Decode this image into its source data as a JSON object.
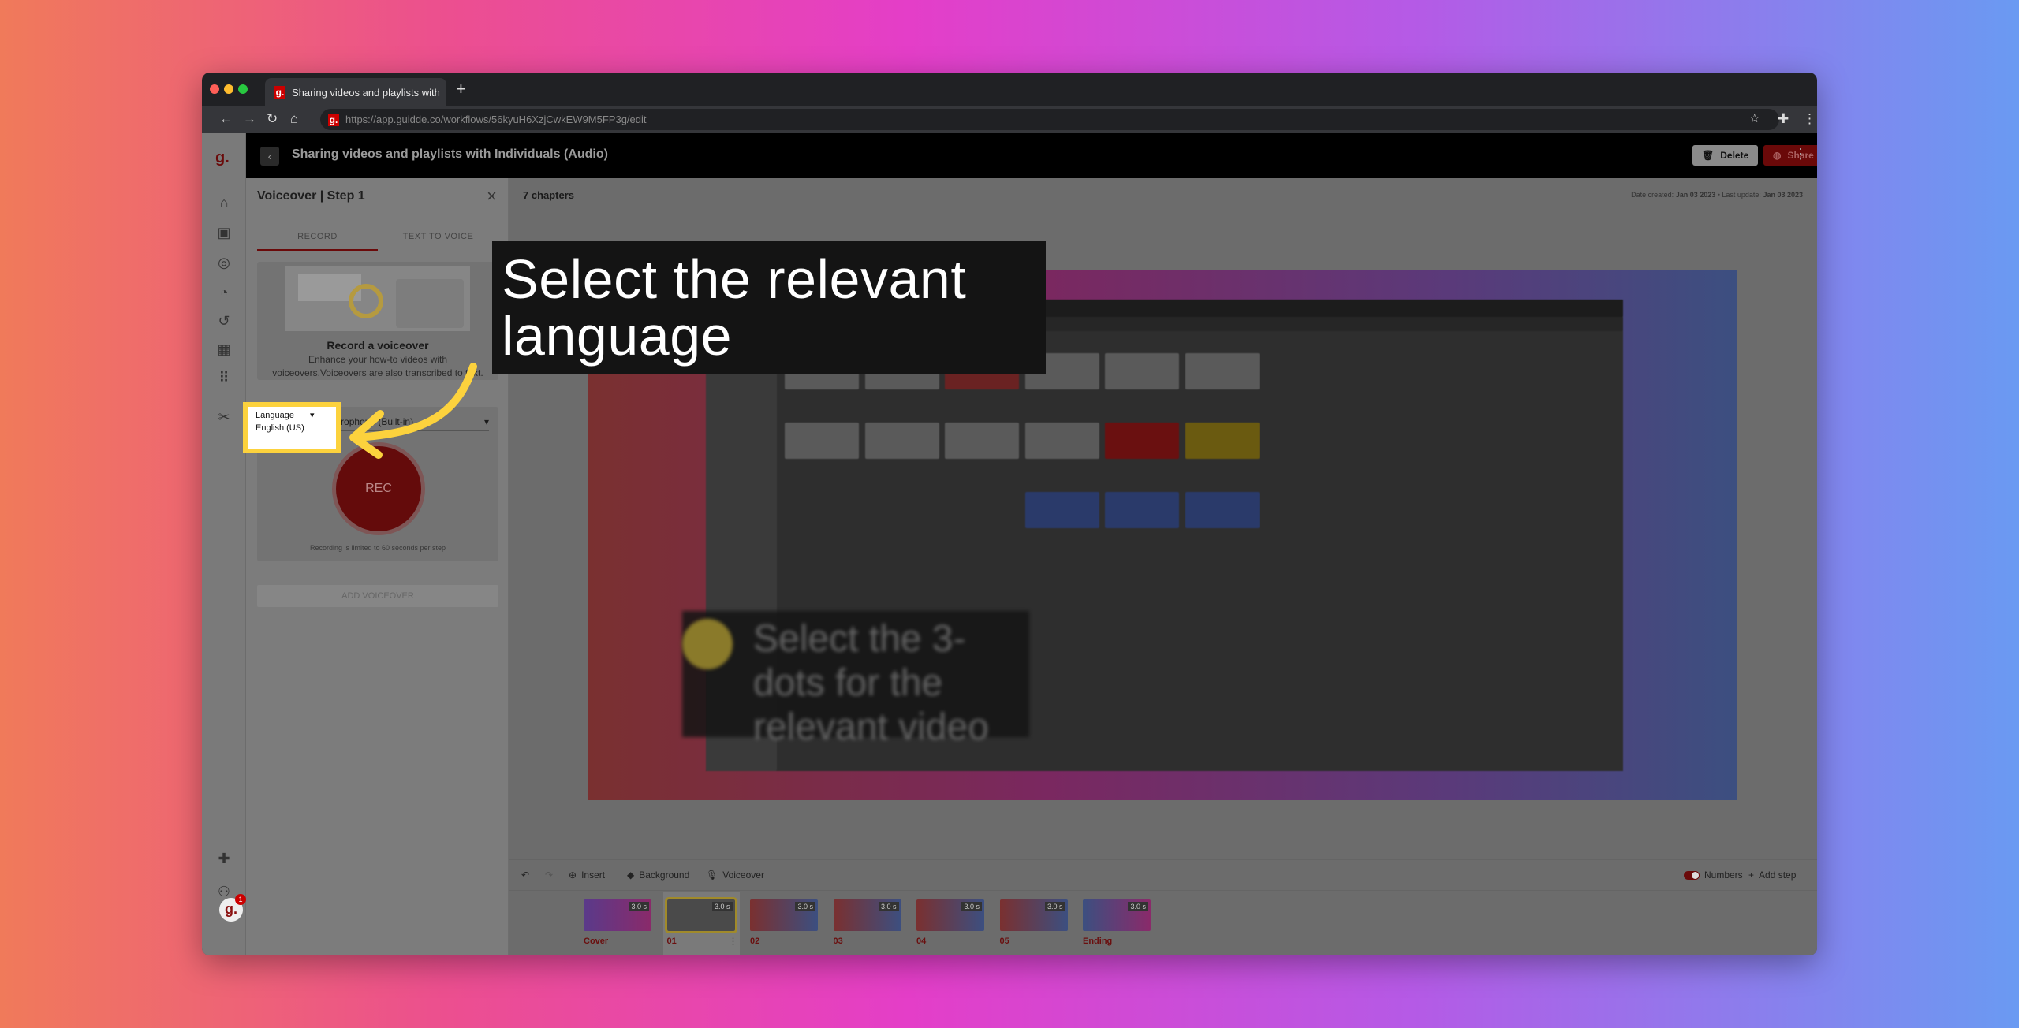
{
  "browser": {
    "tab_title": "Sharing videos and playlists with",
    "url": "https://app.guidde.co/workflows/56kyuH6XzjCwkEW9M5FP3g/edit",
    "favicon": "g."
  },
  "header": {
    "title": "Sharing videos and playlists with Individuals (Audio)",
    "delete_label": "Delete",
    "share_label": "Share"
  },
  "rail": {
    "logo": "g.",
    "icons": [
      "home-icon",
      "video-icon",
      "spaces-icon",
      "insights-icon",
      "activity-icon",
      "organization-icon",
      "apps-icon",
      "tools-icon"
    ],
    "bottom_icons": [
      "extension-icon",
      "add-user-icon"
    ],
    "notif_count": "1"
  },
  "panel": {
    "title": "Voiceover | Step 1",
    "tabs": [
      "RECORD",
      "TEXT TO VOICE"
    ],
    "card_title": "Record a voiceover",
    "card_text": "Enhance your how-to videos with voiceovers.Voiceovers are also transcribed to text.",
    "language_label": "Language",
    "language_value": "English (US)",
    "microphone": "MacBook Pro Microphone (Built-in)",
    "rec_label": "REC",
    "limit_note": "Recording is limited to 60 seconds per step",
    "add_button": "ADD VOICEOVER"
  },
  "main": {
    "chapters": "7 chapters",
    "date_created_label": "Date created:",
    "date_created": "Jan 03 2023",
    "last_update_label": "Last update:",
    "last_update": "Jan 03 2023",
    "preview_caption": "Select the 3-dots for the relevant video"
  },
  "callout": {
    "text": "Select the relevant language"
  },
  "toolbar": {
    "insert": "Insert",
    "background": "Background",
    "voiceover": "Voiceover",
    "numbers": "Numbers",
    "numbers_on": true,
    "add_step": "Add step"
  },
  "filmstrip": [
    {
      "label": "Cover",
      "duration": "3.0 s"
    },
    {
      "label": "01",
      "duration": "3.0 s",
      "selected": true
    },
    {
      "label": "02",
      "duration": "3.0 s"
    },
    {
      "label": "03",
      "duration": "3.0 s"
    },
    {
      "label": "04",
      "duration": "3.0 s"
    },
    {
      "label": "05",
      "duration": "3.0 s"
    },
    {
      "label": "Ending",
      "duration": "3.0 s"
    }
  ],
  "colors": {
    "accent": "#c00000",
    "highlight": "#fcd23d"
  }
}
